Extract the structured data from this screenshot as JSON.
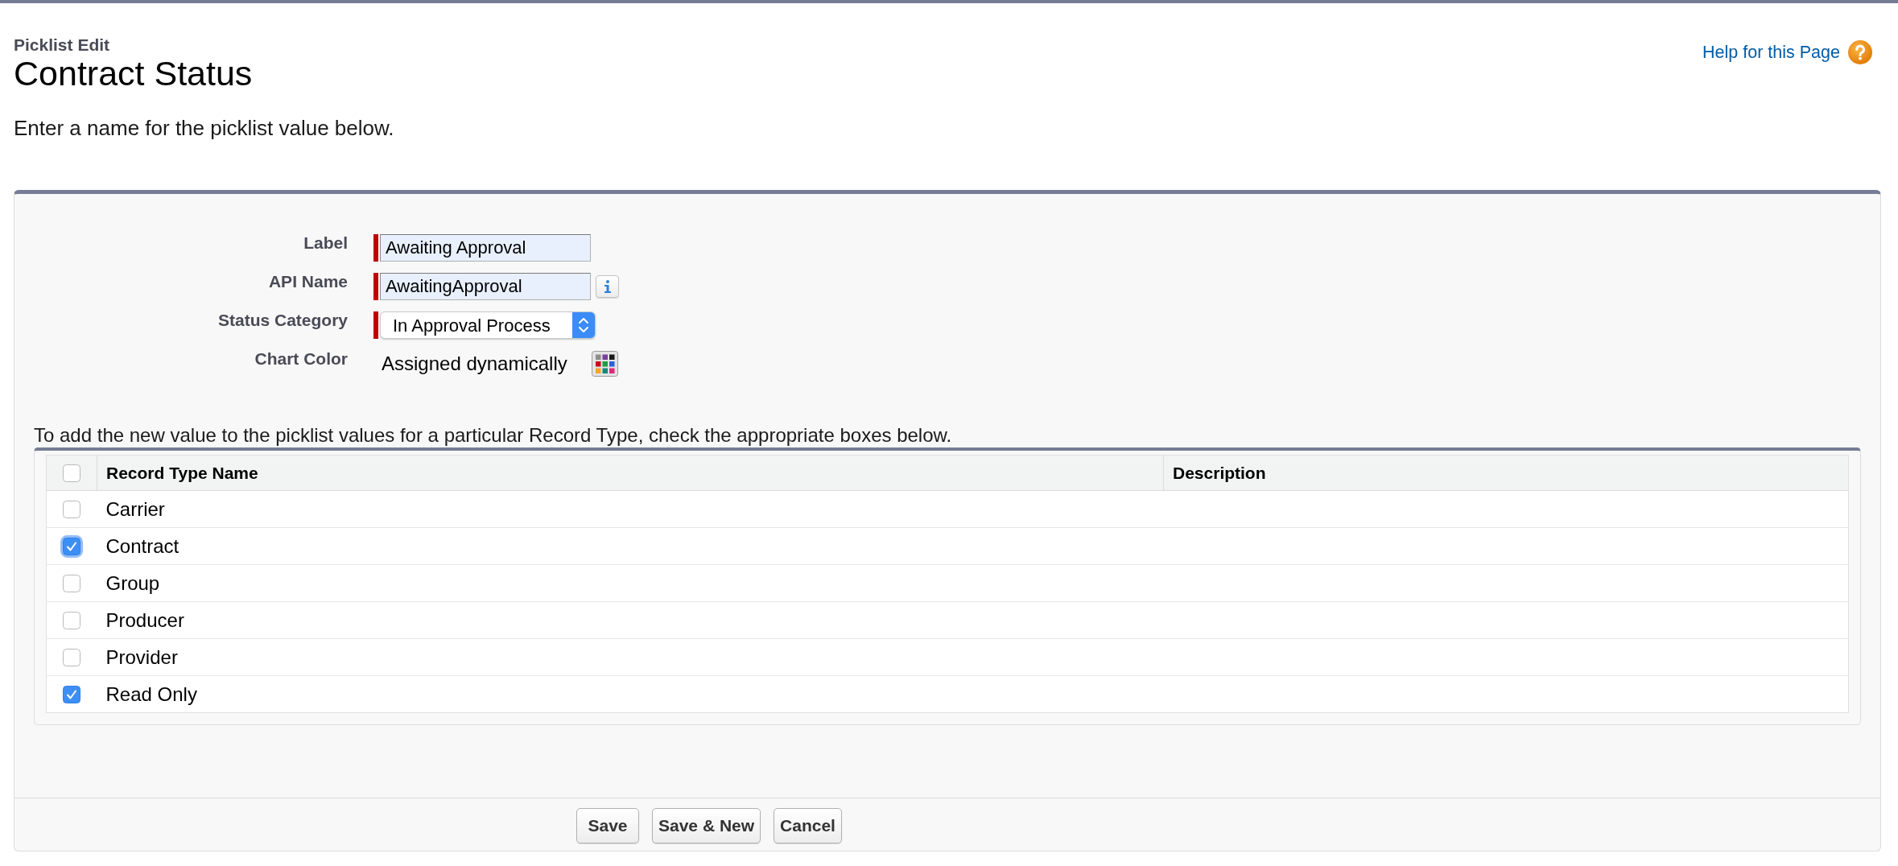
{
  "header": {
    "breadcrumb": "Picklist Edit",
    "title": "Contract Status",
    "help_link": "Help for this Page"
  },
  "intro": "Enter a name for the picklist value below.",
  "form": {
    "fields": [
      {
        "kind": "text",
        "label": "Label",
        "value": "Awaiting Approval",
        "required": true,
        "info_button": false
      },
      {
        "kind": "text",
        "label": "API Name",
        "value": "AwaitingApproval",
        "required": true,
        "info_button": true
      },
      {
        "kind": "select",
        "label": "Status Category",
        "value": "In Approval Process",
        "required": true
      },
      {
        "kind": "color",
        "label": "Chart Color",
        "value": "Assigned dynamically",
        "required": false
      }
    ]
  },
  "record_types": {
    "instruction": "To add the new value to the picklist values for a particular Record Type, check the appropriate boxes below.",
    "select_all": {
      "checked": false
    },
    "columns": [
      "Record Type Name",
      "Description"
    ],
    "rows": [
      {
        "name": "Carrier",
        "checked": false,
        "focused": false
      },
      {
        "name": "Contract",
        "checked": true,
        "focused": true
      },
      {
        "name": "Group",
        "checked": false,
        "focused": false
      },
      {
        "name": "Producer",
        "checked": false,
        "focused": false
      },
      {
        "name": "Provider",
        "checked": false,
        "focused": false
      },
      {
        "name": "Read Only",
        "checked": true,
        "focused": false
      }
    ]
  },
  "buttons": [
    "Save",
    "Save & New",
    "Cancel"
  ]
}
